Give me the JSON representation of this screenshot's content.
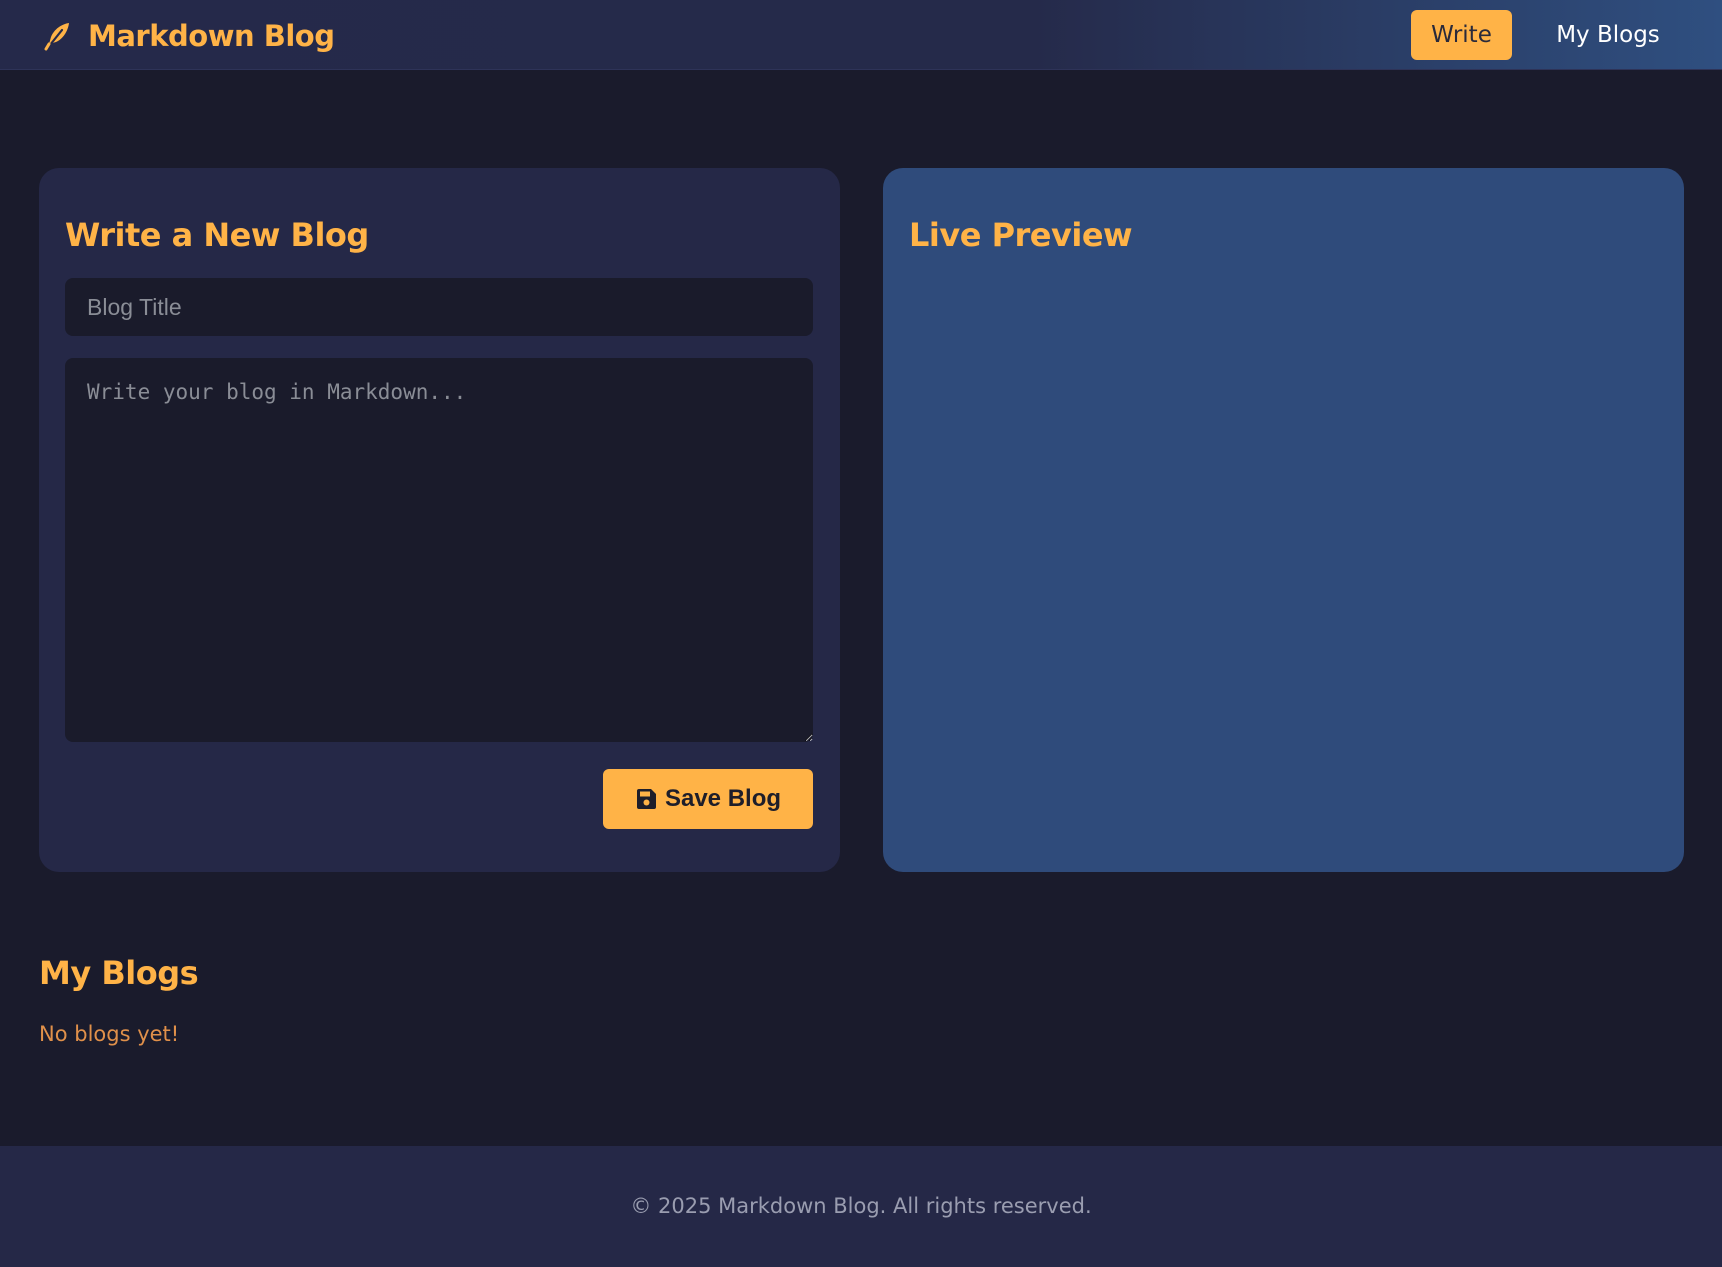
{
  "header": {
    "brand_icon": "feather-pen-icon",
    "brand_name": "Markdown Blog",
    "nav": {
      "write_label": "Write",
      "my_blogs_label": "My Blogs"
    }
  },
  "editor": {
    "heading": "Write a New Blog",
    "title_input": {
      "value": "",
      "placeholder": "Blog Title"
    },
    "body_textarea": {
      "value": "",
      "placeholder": "Write your blog in Markdown..."
    },
    "save_button": {
      "icon": "floppy-disk-icon",
      "label": "Save Blog"
    }
  },
  "preview": {
    "heading": "Live Preview",
    "content": ""
  },
  "blogs_section": {
    "heading": "My Blogs",
    "empty_message": "No blogs yet!"
  },
  "footer": {
    "text": "© 2025 Markdown Blog. All rights reserved."
  },
  "colors": {
    "accent": "#ffb347",
    "background": "#1a1b2c",
    "card": "#252847",
    "preview_card": "#2f4b7b"
  }
}
